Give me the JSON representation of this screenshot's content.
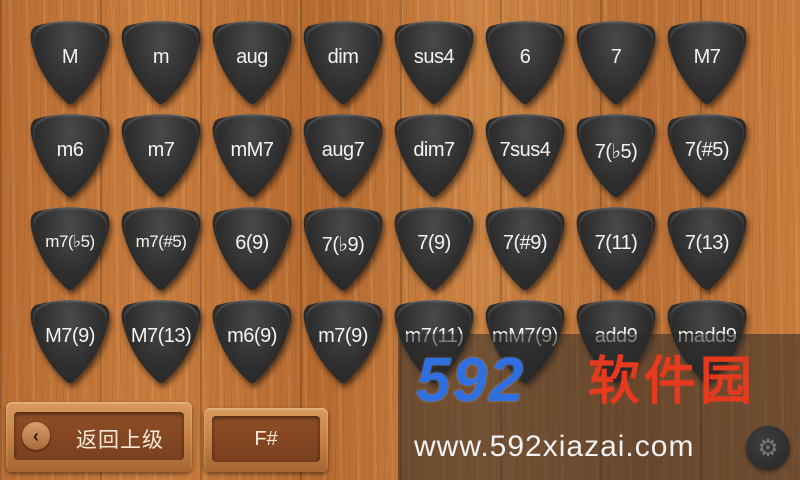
{
  "chords": [
    [
      "M",
      "m",
      "aug",
      "dim",
      "sus4",
      "6",
      "7",
      "M7"
    ],
    [
      "m6",
      "m7",
      "mM7",
      "aug7",
      "dim7",
      "7sus4",
      "7(♭5)",
      "7(#5)"
    ],
    [
      "m7(♭5)",
      "m7(#5)",
      "6(9)",
      "7(♭9)",
      "7(9)",
      "7(#9)",
      "7(11)",
      "7(13)"
    ],
    [
      "M7(9)",
      "M7(13)",
      "m6(9)",
      "m7(9)",
      "m7(11)",
      "mM7(9)",
      "add9",
      "madd9"
    ]
  ],
  "footer": {
    "back_label": "返回上级",
    "back_icon": "chevron-left-icon",
    "key_label": "F#",
    "settings_icon": "gear-icon"
  },
  "watermark": {
    "logo": "592",
    "name": "软件园",
    "url": "www.592xiazai.com"
  }
}
